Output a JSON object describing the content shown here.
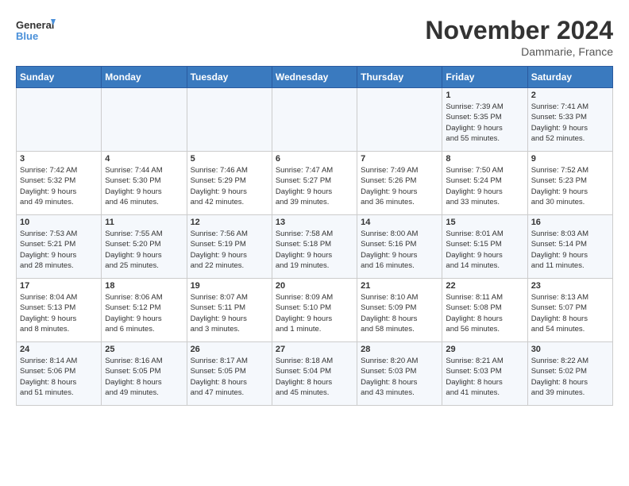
{
  "header": {
    "logo_line1": "General",
    "logo_line2": "Blue",
    "month_title": "November 2024",
    "location": "Dammarie, France"
  },
  "weekdays": [
    "Sunday",
    "Monday",
    "Tuesday",
    "Wednesday",
    "Thursday",
    "Friday",
    "Saturday"
  ],
  "weeks": [
    [
      {
        "day": "",
        "info": ""
      },
      {
        "day": "",
        "info": ""
      },
      {
        "day": "",
        "info": ""
      },
      {
        "day": "",
        "info": ""
      },
      {
        "day": "",
        "info": ""
      },
      {
        "day": "1",
        "info": "Sunrise: 7:39 AM\nSunset: 5:35 PM\nDaylight: 9 hours\nand 55 minutes."
      },
      {
        "day": "2",
        "info": "Sunrise: 7:41 AM\nSunset: 5:33 PM\nDaylight: 9 hours\nand 52 minutes."
      }
    ],
    [
      {
        "day": "3",
        "info": "Sunrise: 7:42 AM\nSunset: 5:32 PM\nDaylight: 9 hours\nand 49 minutes."
      },
      {
        "day": "4",
        "info": "Sunrise: 7:44 AM\nSunset: 5:30 PM\nDaylight: 9 hours\nand 46 minutes."
      },
      {
        "day": "5",
        "info": "Sunrise: 7:46 AM\nSunset: 5:29 PM\nDaylight: 9 hours\nand 42 minutes."
      },
      {
        "day": "6",
        "info": "Sunrise: 7:47 AM\nSunset: 5:27 PM\nDaylight: 9 hours\nand 39 minutes."
      },
      {
        "day": "7",
        "info": "Sunrise: 7:49 AM\nSunset: 5:26 PM\nDaylight: 9 hours\nand 36 minutes."
      },
      {
        "day": "8",
        "info": "Sunrise: 7:50 AM\nSunset: 5:24 PM\nDaylight: 9 hours\nand 33 minutes."
      },
      {
        "day": "9",
        "info": "Sunrise: 7:52 AM\nSunset: 5:23 PM\nDaylight: 9 hours\nand 30 minutes."
      }
    ],
    [
      {
        "day": "10",
        "info": "Sunrise: 7:53 AM\nSunset: 5:21 PM\nDaylight: 9 hours\nand 28 minutes."
      },
      {
        "day": "11",
        "info": "Sunrise: 7:55 AM\nSunset: 5:20 PM\nDaylight: 9 hours\nand 25 minutes."
      },
      {
        "day": "12",
        "info": "Sunrise: 7:56 AM\nSunset: 5:19 PM\nDaylight: 9 hours\nand 22 minutes."
      },
      {
        "day": "13",
        "info": "Sunrise: 7:58 AM\nSunset: 5:18 PM\nDaylight: 9 hours\nand 19 minutes."
      },
      {
        "day": "14",
        "info": "Sunrise: 8:00 AM\nSunset: 5:16 PM\nDaylight: 9 hours\nand 16 minutes."
      },
      {
        "day": "15",
        "info": "Sunrise: 8:01 AM\nSunset: 5:15 PM\nDaylight: 9 hours\nand 14 minutes."
      },
      {
        "day": "16",
        "info": "Sunrise: 8:03 AM\nSunset: 5:14 PM\nDaylight: 9 hours\nand 11 minutes."
      }
    ],
    [
      {
        "day": "17",
        "info": "Sunrise: 8:04 AM\nSunset: 5:13 PM\nDaylight: 9 hours\nand 8 minutes."
      },
      {
        "day": "18",
        "info": "Sunrise: 8:06 AM\nSunset: 5:12 PM\nDaylight: 9 hours\nand 6 minutes."
      },
      {
        "day": "19",
        "info": "Sunrise: 8:07 AM\nSunset: 5:11 PM\nDaylight: 9 hours\nand 3 minutes."
      },
      {
        "day": "20",
        "info": "Sunrise: 8:09 AM\nSunset: 5:10 PM\nDaylight: 9 hours\nand 1 minute."
      },
      {
        "day": "21",
        "info": "Sunrise: 8:10 AM\nSunset: 5:09 PM\nDaylight: 8 hours\nand 58 minutes."
      },
      {
        "day": "22",
        "info": "Sunrise: 8:11 AM\nSunset: 5:08 PM\nDaylight: 8 hours\nand 56 minutes."
      },
      {
        "day": "23",
        "info": "Sunrise: 8:13 AM\nSunset: 5:07 PM\nDaylight: 8 hours\nand 54 minutes."
      }
    ],
    [
      {
        "day": "24",
        "info": "Sunrise: 8:14 AM\nSunset: 5:06 PM\nDaylight: 8 hours\nand 51 minutes."
      },
      {
        "day": "25",
        "info": "Sunrise: 8:16 AM\nSunset: 5:05 PM\nDaylight: 8 hours\nand 49 minutes."
      },
      {
        "day": "26",
        "info": "Sunrise: 8:17 AM\nSunset: 5:05 PM\nDaylight: 8 hours\nand 47 minutes."
      },
      {
        "day": "27",
        "info": "Sunrise: 8:18 AM\nSunset: 5:04 PM\nDaylight: 8 hours\nand 45 minutes."
      },
      {
        "day": "28",
        "info": "Sunrise: 8:20 AM\nSunset: 5:03 PM\nDaylight: 8 hours\nand 43 minutes."
      },
      {
        "day": "29",
        "info": "Sunrise: 8:21 AM\nSunset: 5:03 PM\nDaylight: 8 hours\nand 41 minutes."
      },
      {
        "day": "30",
        "info": "Sunrise: 8:22 AM\nSunset: 5:02 PM\nDaylight: 8 hours\nand 39 minutes."
      }
    ]
  ]
}
